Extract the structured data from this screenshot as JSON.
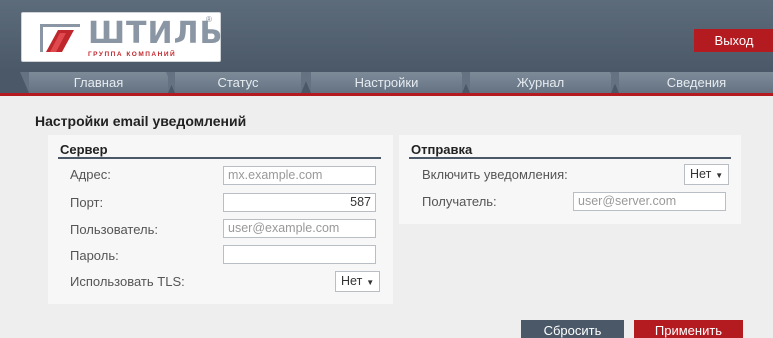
{
  "header": {
    "logo_text": "ШТИЛЬ",
    "logo_reg": "®",
    "logo_sub": "ГРУППА КОМПАНИЙ",
    "logout_label": "Выход"
  },
  "nav": {
    "tabs": [
      "Главная",
      "Статус",
      "Настройки",
      "Журнал",
      "Сведения"
    ]
  },
  "page": {
    "title": "Настройки email уведомлений"
  },
  "server": {
    "heading": "Сервер",
    "address_label": "Адрес:",
    "address_placeholder": "mx.example.com",
    "port_label": "Порт:",
    "port_value": "587",
    "user_label": "Пользователь:",
    "user_placeholder": "user@example.com",
    "password_label": "Пароль:",
    "password_value": "",
    "tls_label": "Использовать TLS:",
    "tls_value": "Нет"
  },
  "sending": {
    "heading": "Отправка",
    "enable_label": "Включить уведомления:",
    "enable_value": "Нет",
    "recipient_label": "Получатель:",
    "recipient_placeholder": "user@server.com"
  },
  "actions": {
    "reset_label": "Сбросить",
    "apply_label": "Применить"
  },
  "colors": {
    "header": "#4a5868",
    "accent_red": "#b31b21",
    "panel": "#f7f7f7"
  }
}
